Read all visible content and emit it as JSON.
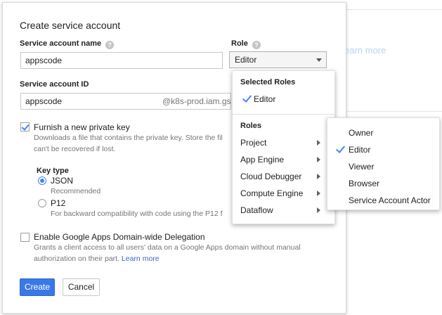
{
  "background": {
    "learn_more": "earn more"
  },
  "dialog": {
    "title": "Create service account",
    "name_field": {
      "label": "Service account name",
      "value": "appscode"
    },
    "role_field": {
      "label": "Role",
      "selected": "Editor"
    },
    "id_field": {
      "label": "Service account ID",
      "value": "appscode",
      "suffix": "@k8s-prod.iam.gs"
    },
    "private_key": {
      "label": "Furnish a new private key",
      "checked": true,
      "desc_line1": "Downloads a file that contains the private key. Store the fil",
      "desc_line2": "can't be recovered if lost."
    },
    "key_type": {
      "label": "Key type",
      "options": [
        {
          "label": "JSON",
          "desc": "Recommended",
          "selected": true
        },
        {
          "label": "P12",
          "desc": "For backward compatibility with code using the P12 f",
          "selected": false
        }
      ]
    },
    "delegation": {
      "label": "Enable Google Apps Domain-wide Delegation",
      "checked": false,
      "desc_line1": "Grants a client access to all users' data on a Google Apps domain without manual",
      "desc_line2_prefix": "authorization on their part. ",
      "learn_more": "Learn more"
    },
    "create_label": "Create",
    "cancel_label": "Cancel"
  },
  "role_menu": {
    "selected_heading": "Selected Roles",
    "selected_items": [
      "Editor"
    ],
    "roles_heading": "Roles",
    "roles": [
      "Project",
      "App Engine",
      "Cloud Debugger",
      "Compute Engine",
      "Dataflow"
    ]
  },
  "submenu": {
    "items": [
      "Owner",
      "Editor",
      "Viewer",
      "Browser",
      "Service Account Actor"
    ],
    "checked": "Editor"
  },
  "colors": {
    "accent": "#4285f4",
    "primary_button": "#3b78e7",
    "link": "#3367d6"
  }
}
